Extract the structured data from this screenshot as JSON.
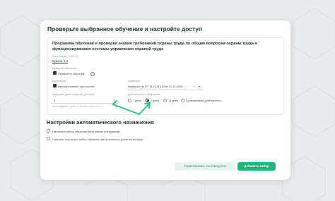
{
  "page_title": "Проверьте выбранное обучение и настройте доступ",
  "program": {
    "title": "Программа обучения и проверки знания требований охраны труда по общим вопросам охраны труда и функционирования системы управления охраной труда",
    "annotation": "Аннотация: 1000-00",
    "courses_link": "Курсов: 1"
  },
  "training": {
    "label": "Признаки обучения",
    "primary_checkbox_label": "Первичное обучение",
    "primary_checked": true
  },
  "protocols": {
    "label": "Протоколы",
    "auto_checkbox_label": "Автозаполнение протоколов",
    "auto_checked": true
  },
  "commission": {
    "label": "Комиссия",
    "value": "Комиссия по ОТ 11.12-М 129 от 11.12.2024",
    "clear_icon": "close-icon",
    "dropdown_icon": "chevron-down-icon"
  },
  "delay": {
    "label": "Задержка даты открытия доступа",
    "value": "0",
    "hint": "Календарных дней с начала обучения"
  },
  "duration": {
    "label": "Длительность программы",
    "options": [
      "1 день",
      "7 дней",
      "14 дней",
      "Произвольная длительность"
    ],
    "selected_index": 1
  },
  "auto_assign": {
    "title": "Настройки автоматического назначения",
    "options": [
      {
        "label": "Назначать набор обучения всем новым сотрудникам",
        "checked": false
      },
      {
        "label": "Повторно назначать набор обучения при истечении сроков аттестации",
        "checked": false
      }
    ]
  },
  "buttons": {
    "edit_courses": "Редактировать состав курсов",
    "add_set": "Добавить набор"
  },
  "colors": {
    "accent": "#24b27a",
    "secondary_bg": "#e9f4f0",
    "secondary_text": "#3c7f68"
  }
}
